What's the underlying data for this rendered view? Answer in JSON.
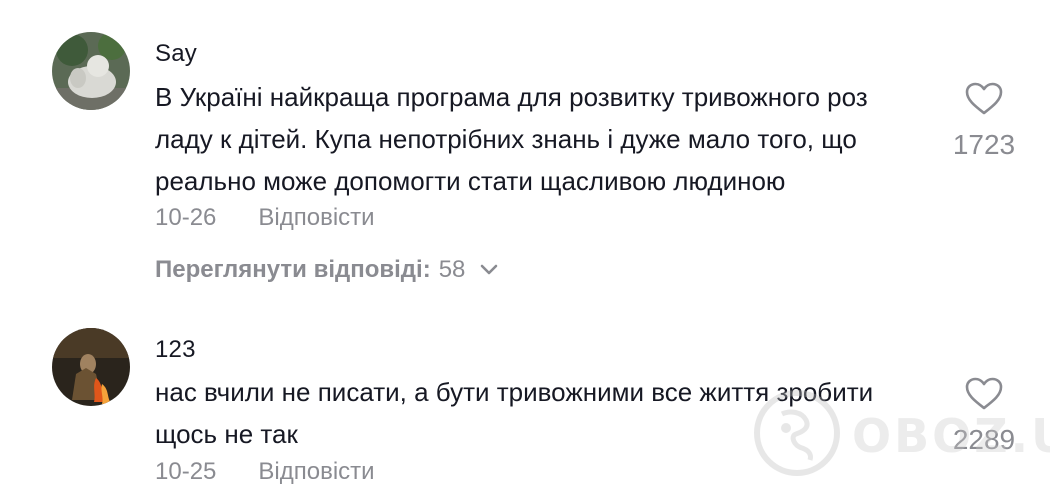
{
  "comments": [
    {
      "username": "Say",
      "text_lines": [
        "В Україні найкраща програма для розвитку тривожного роз",
        "ладу к дітей. Купа непотрібних знань і дуже мало того, що",
        "реально може допомогти стати щасливою людиною"
      ],
      "date": "10-26",
      "reply_label": "Відповісти",
      "view_replies_label": "Переглянути відповіді:",
      "view_replies_count": "58",
      "like_count": "1723"
    },
    {
      "username": "123",
      "text_lines": [
        "нас вчили не писати, а бути тривожними все життя зробити",
        "щось не так"
      ],
      "date": "10-25",
      "reply_label": "Відповісти",
      "like_count": "2289"
    }
  ],
  "watermark": {
    "text": "OBOZ.UA"
  },
  "icons": {
    "like": "heart-outline-icon",
    "expand": "chevron-down-icon",
    "watermark_logo": "globe-icon"
  },
  "colors": {
    "text_primary": "#161823",
    "text_secondary": "#8a8b91",
    "background": "#ffffff"
  }
}
